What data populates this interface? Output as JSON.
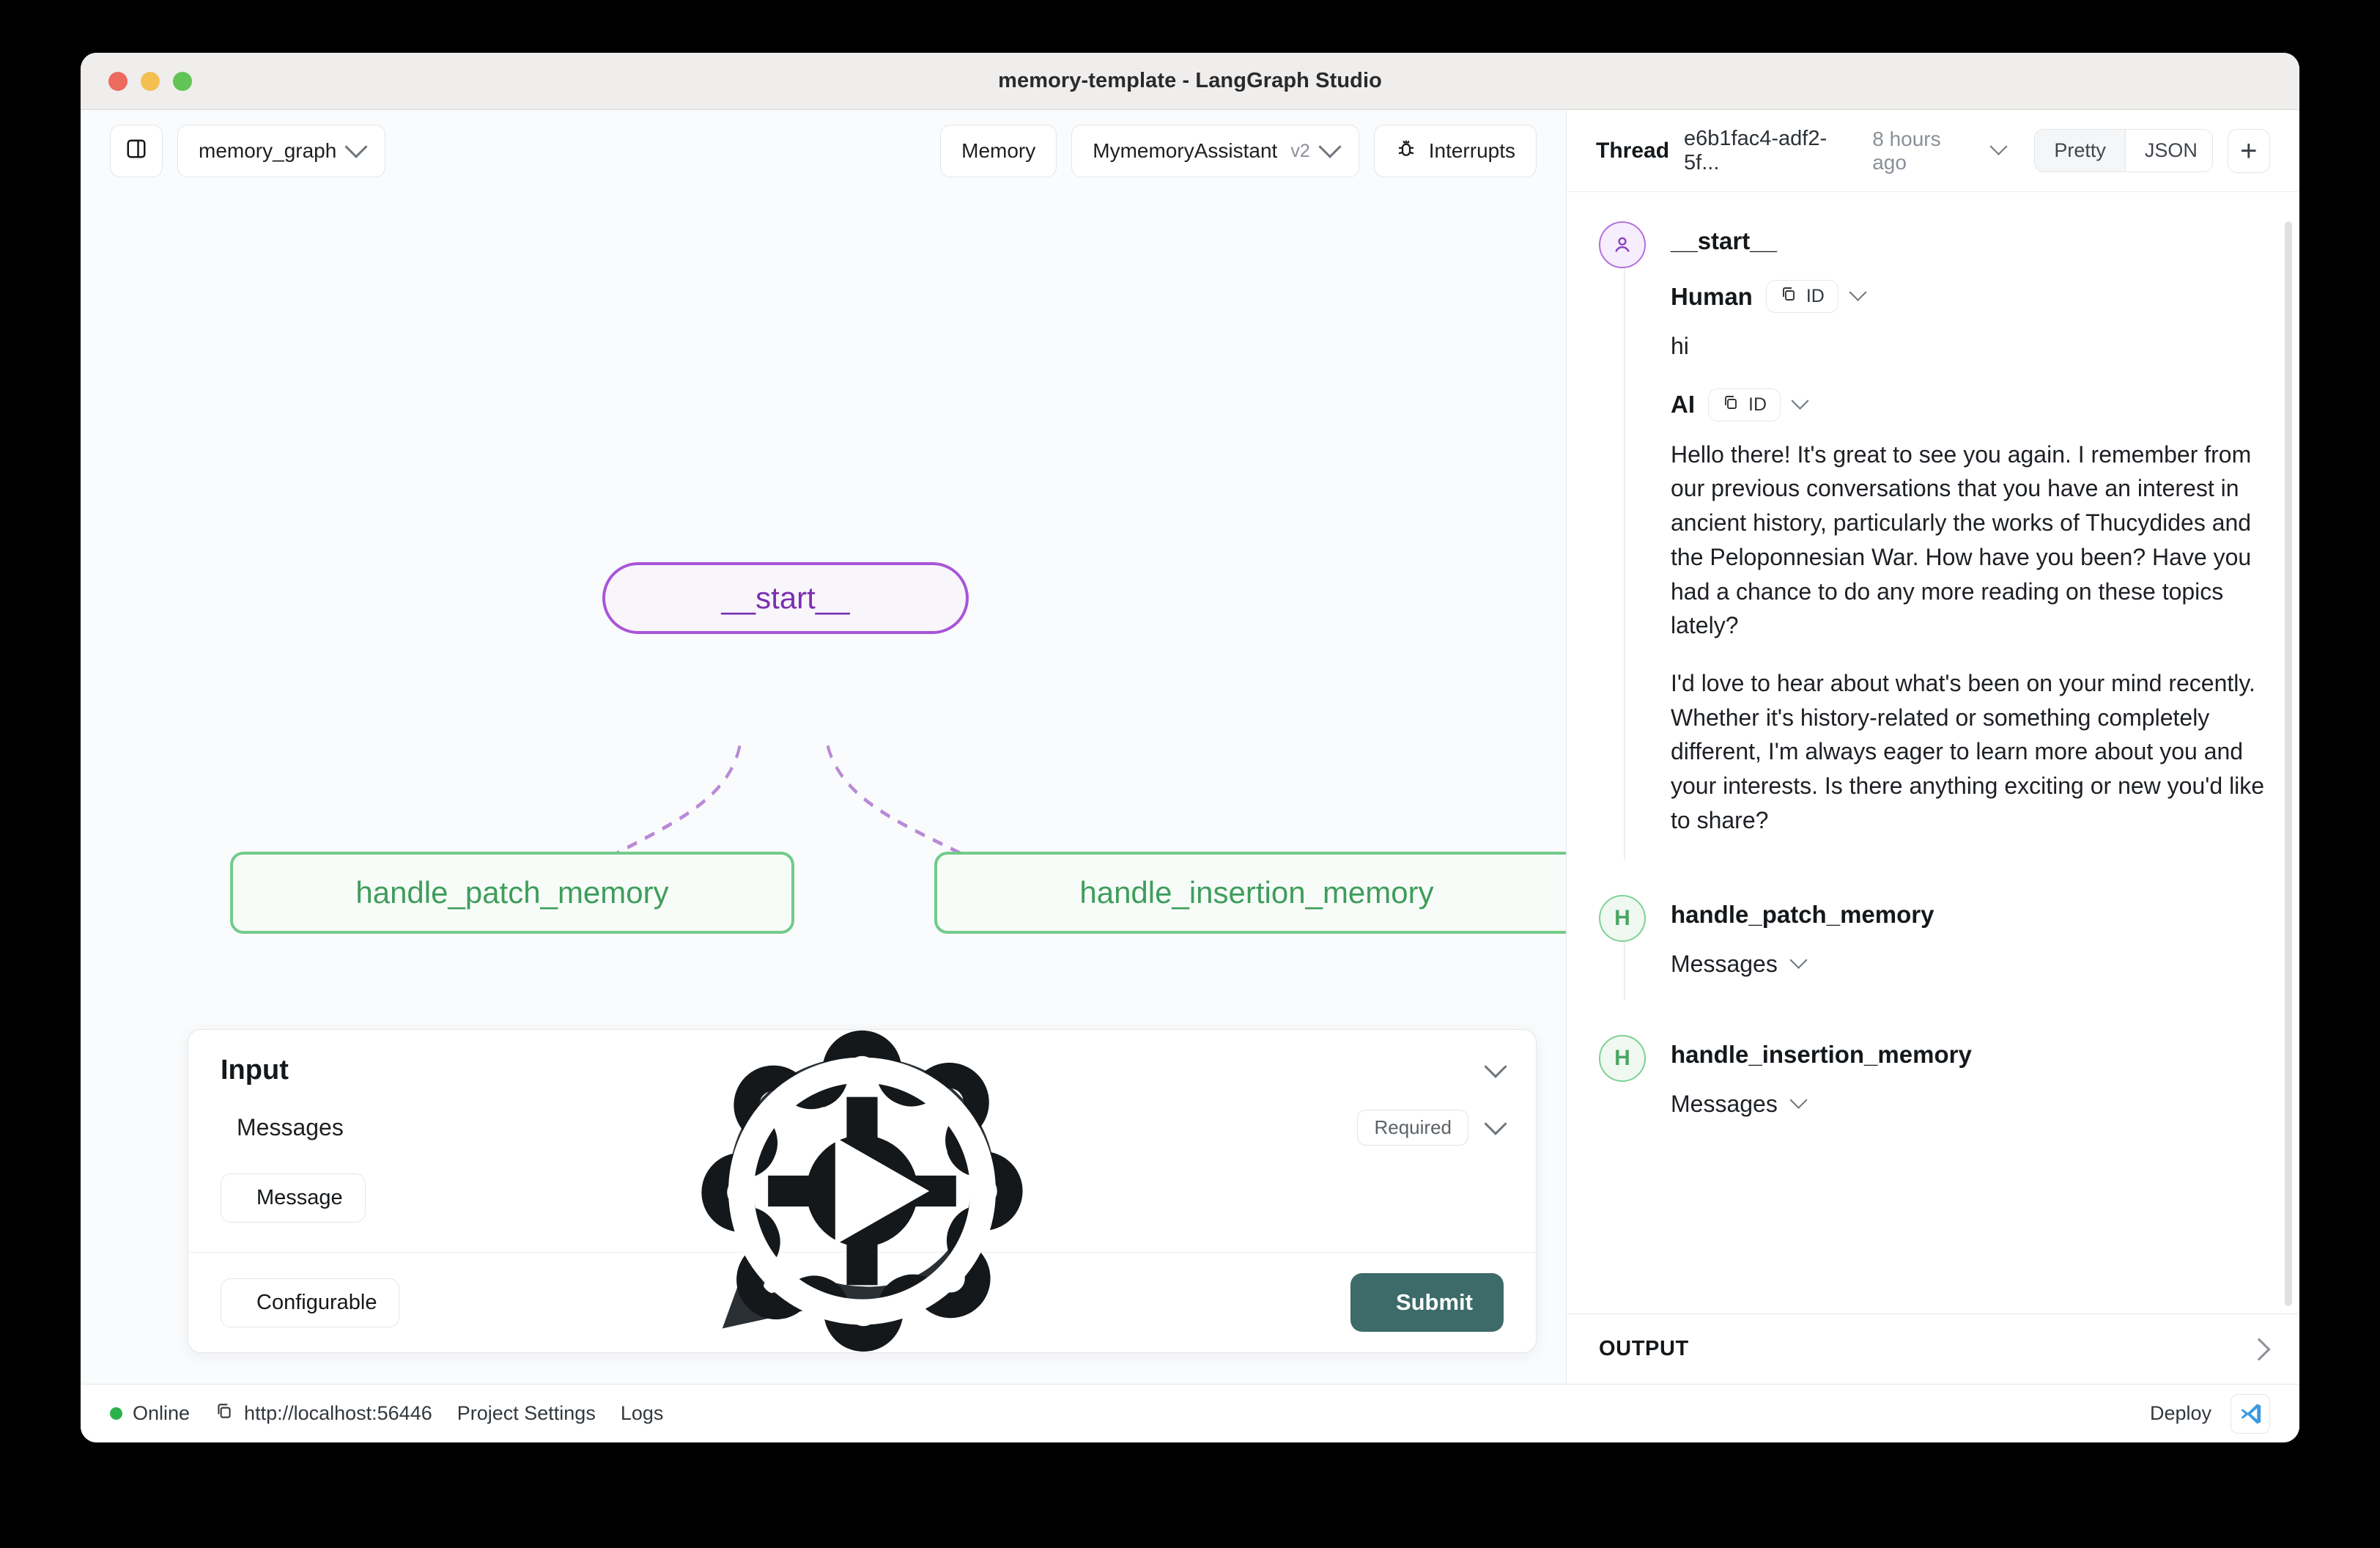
{
  "window": {
    "title": "memory-template - LangGraph Studio"
  },
  "toolbar": {
    "sidebar_toggle_icon": "panel-left-icon",
    "graph_select": "memory_graph",
    "memory_button": "Memory",
    "assistant_name": "MymemoryAssistant",
    "assistant_version": "v2",
    "interrupts_button": "Interrupts",
    "interrupts_icon": "bug-icon"
  },
  "graph": {
    "nodes": [
      {
        "id": "start",
        "label": "__start__",
        "color": "#a855d8"
      },
      {
        "id": "patch",
        "label": "handle_patch_memory",
        "color": "#72cb8a"
      },
      {
        "id": "insertion",
        "label": "handle_insertion_memory",
        "color": "#72cb8a"
      }
    ],
    "edge_color": "#b98ad6"
  },
  "input_panel": {
    "title": "Input",
    "collapse_icon": "chevron-down-icon",
    "messages_label": "Messages",
    "messages_icon": "chat-bubble-icon",
    "required_badge": "Required",
    "add_message_button": "Message",
    "add_icon": "plus-icon",
    "configurable_button": "Configurable",
    "configurable_icon": "gear-icon",
    "submit_button": "Submit",
    "submit_icon": "play-circle-icon",
    "submit_color": "#3c6b69"
  },
  "statusbar": {
    "status": "Online",
    "status_color": "#2bb24c",
    "url": "http://localhost:56446",
    "copy_icon": "copy-icon",
    "project_settings": "Project Settings",
    "logs": "Logs",
    "deploy": "Deploy",
    "vscode_icon": "vscode-icon"
  },
  "thread": {
    "label": "Thread",
    "id": "e6b1fac4-adf2-5f...",
    "time": "8 hours ago",
    "view_modes": [
      {
        "label": "Pretty",
        "active": true
      },
      {
        "label": "JSON",
        "active": false
      }
    ],
    "new_thread_icon": "plus-icon",
    "entries": [
      {
        "avatar": "user-icon",
        "avatar_type": "purple",
        "title": "__start__",
        "messages": [
          {
            "role": "Human",
            "id_chip": "ID",
            "text": "hi"
          },
          {
            "role": "AI",
            "id_chip": "ID",
            "paragraphs": [
              "Hello there! It's great to see you again. I remember from our previous conversations that you have an interest in ancient history, particularly the works of Thucydides and the Peloponnesian War. How have you been? Have you had a chance to do any more reading on these topics lately?",
              "I'd love to hear about what's been on your mind recently. Whether it's history-related or something completely different, I'm always eager to learn more about you and your interests. Is there anything exciting or new you'd like to share?"
            ]
          }
        ]
      },
      {
        "avatar": "H",
        "avatar_type": "green",
        "title": "handle_patch_memory",
        "collapsed_label": "Messages"
      },
      {
        "avatar": "H",
        "avatar_type": "green",
        "title": "handle_insertion_memory",
        "collapsed_label": "Messages"
      }
    ],
    "output_label": "OUTPUT"
  }
}
